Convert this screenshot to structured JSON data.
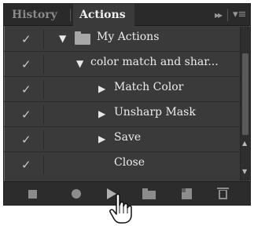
{
  "header": {
    "tabs": [
      {
        "label": "History"
      },
      {
        "label": "Actions"
      }
    ],
    "collapse_glyph": "▸▸",
    "menu_glyph": "▾≡"
  },
  "glyphs": {
    "check": "✓",
    "expanded": "▼",
    "collapsed": "▶"
  },
  "rows": [
    {
      "label": "My Actions",
      "expanded": true,
      "kind": "set"
    },
    {
      "label": "color match and shar...",
      "expanded": true,
      "kind": "action"
    },
    {
      "label": "Match Color",
      "expanded": false,
      "kind": "step"
    },
    {
      "label": "Unsharp Mask",
      "expanded": false,
      "kind": "step"
    },
    {
      "label": "Save",
      "expanded": false,
      "kind": "step"
    },
    {
      "label": "Close",
      "expanded": false,
      "kind": "step"
    }
  ],
  "scrollbar": {
    "up": "▲",
    "down": "▼"
  },
  "footer": {
    "buttons": [
      "stop-icon",
      "record-icon",
      "play-icon",
      "new-set-icon",
      "new-action-icon",
      "delete-icon"
    ]
  },
  "colors": {
    "panel_bg": "#3a3a3a",
    "header_bg": "#2a2a2a",
    "text": "#ececec",
    "inactive_tab": "#8a8a8a"
  }
}
